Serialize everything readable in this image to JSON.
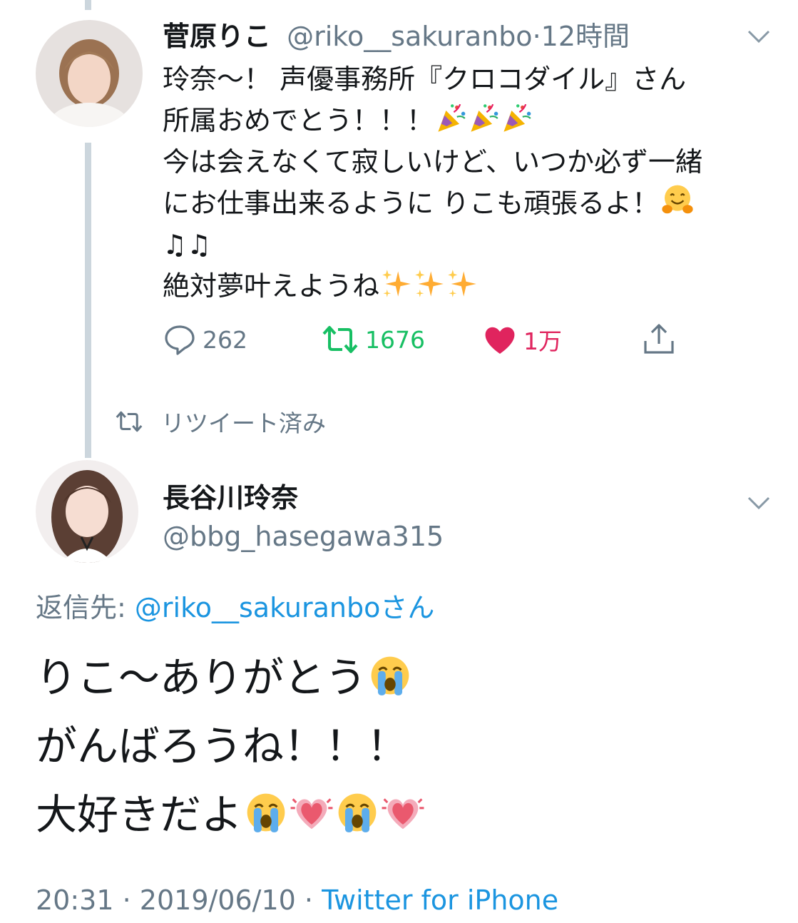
{
  "parent_tweet": {
    "author_name": "菅原りこ",
    "handle": "@riko__sakuranbo",
    "separator": "·",
    "time": "12時間",
    "lines": [
      "玲奈〜！ 声優事務所『クロコダイル』さん",
      "所属おめでとう！！！",
      "今は会えなくて寂しいけど、いつか必ず一緒",
      "にお仕事出来るように りこも頑張るよ！",
      "♫♫",
      "絶対夢叶えようね"
    ],
    "emoji": {
      "line2": [
        "party-popper",
        "party-popper",
        "party-popper"
      ],
      "line4": [
        "hugging-face"
      ],
      "line6": [
        "sparkles",
        "sparkles",
        "sparkles"
      ]
    },
    "actions": {
      "reply_count": "262",
      "retweet_count": "1676",
      "like_count": "1万"
    },
    "colors": {
      "retweet_active": "#17bf63",
      "like_active": "#e0245e"
    }
  },
  "retweet_indicator": {
    "label": "リツイート済み"
  },
  "reply_tweet": {
    "author_name": "長谷川玲奈",
    "handle": "@bbg_hasegawa315",
    "reply_to_label": "返信先:",
    "reply_to_handle": "@riko__sakuranbo",
    "reply_to_suffix": "さん",
    "lines": [
      "りこ〜ありがとう",
      "がんばろうね！！！",
      "大好きだよ"
    ],
    "emoji": {
      "line1": [
        "loudly-crying-face"
      ],
      "line3": [
        "loudly-crying-face",
        "growing-heart",
        "loudly-crying-face",
        "growing-heart"
      ]
    },
    "footer_time": "20:31",
    "footer_date": "2019/06/10",
    "footer_separator": "·",
    "footer_source": "Twitter for iPhone"
  },
  "colors": {
    "link": "#1b95e0",
    "secondary_text": "#657786",
    "thread_line": "#ccd6dd"
  }
}
